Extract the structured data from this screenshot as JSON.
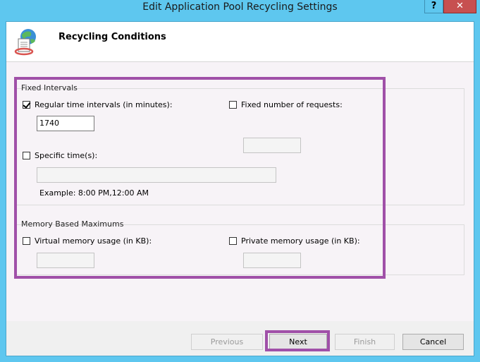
{
  "window": {
    "title": "Edit Application Pool Recycling Settings",
    "help_label": "?",
    "close_label": "✕"
  },
  "header": {
    "title": "Recycling Conditions",
    "icon": "recycle-globe-icon"
  },
  "fixed_intervals": {
    "group_label": "Fixed Intervals",
    "regular_time": {
      "label": "Regular time intervals (in minutes):",
      "checked": true,
      "value": "1740"
    },
    "fixed_requests": {
      "label": "Fixed number of requests:",
      "checked": false,
      "value": ""
    },
    "specific_time": {
      "label": "Specific time(s):",
      "checked": false,
      "value": ""
    },
    "example": "Example: 8:00 PM,12:00 AM"
  },
  "memory": {
    "group_label": "Memory Based Maximums",
    "virtual": {
      "label": "Virtual memory usage (in KB):",
      "checked": false,
      "value": ""
    },
    "private": {
      "label": "Private memory usage (in KB):",
      "checked": false,
      "value": ""
    }
  },
  "buttons": {
    "previous": "Previous",
    "next": "Next",
    "finish": "Finish",
    "cancel": "Cancel"
  },
  "colors": {
    "highlight": "#a050a8",
    "titlebar": "#5ec7ef",
    "close": "#c75050"
  }
}
